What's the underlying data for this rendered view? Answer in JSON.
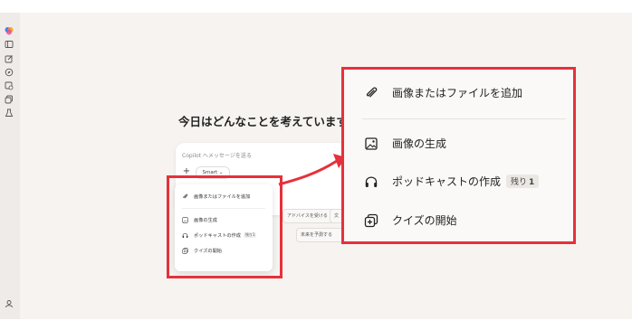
{
  "sidebar": {
    "icons": [
      "copilot-logo-icon",
      "sidebar-toggle-icon",
      "new-chat-icon",
      "discover-icon",
      "images-icon",
      "pages-icon",
      "labs-icon"
    ],
    "bottom_icon": "account-icon"
  },
  "main": {
    "greeting": "今日はどんなことを考えていますか?",
    "composer": {
      "placeholder": "Copilot へメッセージを送る",
      "plus_label": "+",
      "mode_label": "Smart ⌄"
    },
    "chips": [
      "アドバイスを受ける",
      "文",
      "未来を予測する"
    ]
  },
  "attach_menu_small": {
    "items": [
      {
        "label": "画像またはファイルを追加",
        "icon": "paperclip-icon"
      },
      {
        "label": "画像の生成",
        "icon": "image-generate-icon"
      },
      {
        "label": "ポッドキャストの作成",
        "icon": "headphones-icon",
        "badge": "残り1"
      },
      {
        "label": "クイズの開始",
        "icon": "quiz-icon"
      }
    ]
  },
  "attach_menu_zoomed": {
    "items": [
      {
        "label": "画像またはファイルを追加",
        "icon": "paperclip-icon"
      },
      {
        "label": "画像の生成",
        "icon": "image-generate-icon"
      },
      {
        "label": "ポッドキャストの作成",
        "icon": "headphones-icon",
        "badge_text": "残り",
        "badge_count": "1"
      },
      {
        "label": "クイズの開始",
        "icon": "quiz-icon"
      }
    ]
  },
  "colors": {
    "highlight": "#e5313b",
    "background": "#f6f3f0",
    "menu_background": "#fbf9f7"
  }
}
